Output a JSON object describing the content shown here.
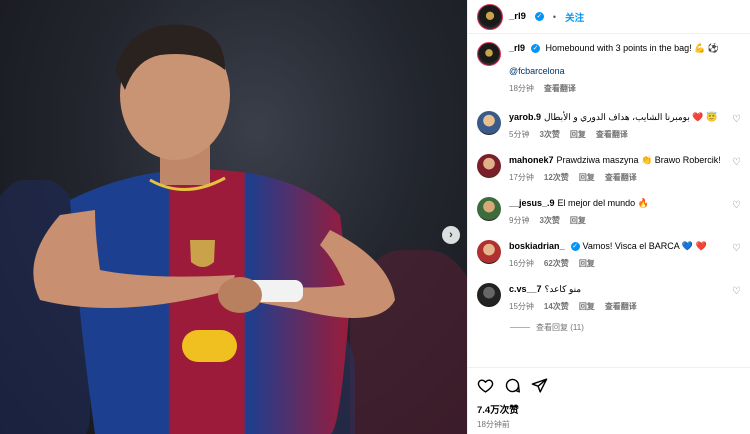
{
  "header": {
    "username": "_rl9",
    "separator": "•",
    "follow_label": "关注"
  },
  "photo": {
    "next_glyph": "›"
  },
  "caption": {
    "username": "_rl9",
    "text": "Homebound with 3 points in the bag! 💪 ⚽",
    "mention": "@fcbarcelona",
    "time": "18分钟",
    "translate": "查看翻译"
  },
  "comments": [
    {
      "username": "yarob.9",
      "text": "بومبرنا الشايب، هداف الدوري و الأبطال ❤️ 😇",
      "time": "5分钟",
      "likes": "3次赞",
      "reply": "回复",
      "translate": "查看翻译"
    },
    {
      "username": "mahonek7",
      "text": "Prawdziwa maszyna 👏 Brawo Robercik!",
      "time": "17分钟",
      "likes": "12次赞",
      "reply": "回复",
      "translate": "查看翻译"
    },
    {
      "username": "__jesus_.9",
      "text": "El mejor del mundo 🔥",
      "time": "9分钟",
      "likes": "3次赞",
      "reply": "回复"
    },
    {
      "username": "boskiadrian_",
      "text": "Vamos! Visca el BARCA 💙 ❤️",
      "time": "16分钟",
      "likes": "62次赞",
      "reply": "回复"
    },
    {
      "username": "c.vs__7",
      "text": "منو كاعد؟",
      "time": "15分钟",
      "likes": "14次赞",
      "reply": "回复",
      "translate": "查看翻译",
      "more_replies": "查看回复 (11)"
    }
  ],
  "footer": {
    "likes": "7.4万次赞",
    "time": "18分钟前"
  },
  "colors": {
    "accent": "#0095f6",
    "barca_blue": "#1c3f8f",
    "barca_red": "#9c1b3a"
  }
}
